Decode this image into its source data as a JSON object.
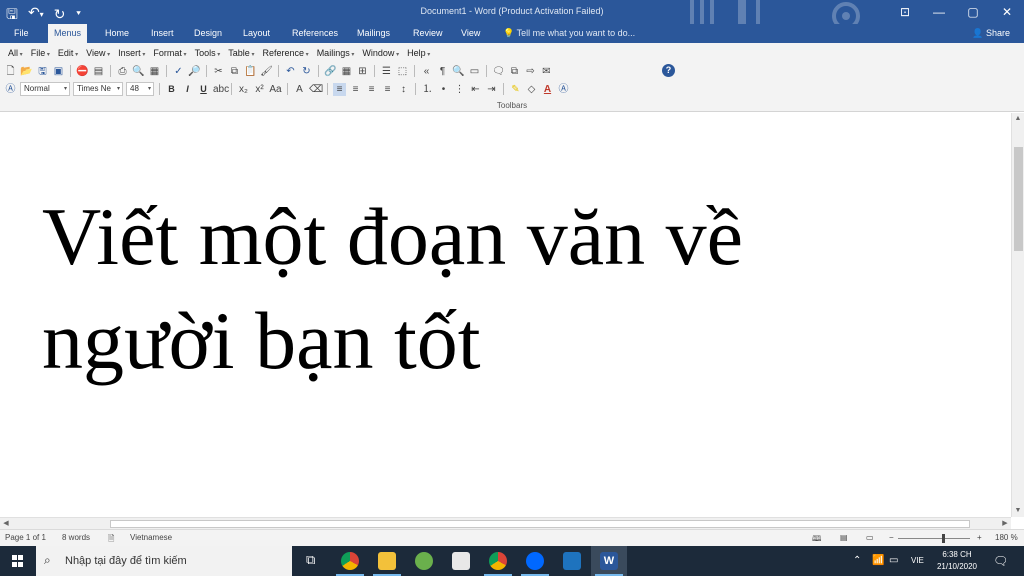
{
  "titlebar": {
    "title": "Document1 - Word (Product Activation Failed)",
    "controls": [
      "⊡",
      "—",
      "▢",
      "✕"
    ]
  },
  "tabs": [
    {
      "label": "File"
    },
    {
      "label": "Menus"
    },
    {
      "label": "Home"
    },
    {
      "label": "Insert"
    },
    {
      "label": "Design"
    },
    {
      "label": "Layout"
    },
    {
      "label": "References"
    },
    {
      "label": "Mailings"
    },
    {
      "label": "Review"
    },
    {
      "label": "View"
    }
  ],
  "tellme": "Tell me what you want to do...",
  "share": "Share",
  "menubar": [
    "All",
    "File",
    "Edit",
    "View",
    "Insert",
    "Format",
    "Tools",
    "Table",
    "Reference",
    "Mailings",
    "Window",
    "Help"
  ],
  "format": {
    "style": "Normal",
    "font": "Times Ne",
    "size": "48",
    "bold": "B",
    "italic": "I",
    "underline": "U"
  },
  "toolbars_label": "Toolbars",
  "document": {
    "line1": "Viết một đoạn văn về",
    "line2": "người bạn tốt"
  },
  "status": {
    "page": "Page 1 of 1",
    "words": "8 words",
    "language": "Vietnamese",
    "zoom": "180 %",
    "zoom_percent": 180
  },
  "taskbar": {
    "search_placeholder": "Nhập tại đây để tìm kiếm",
    "language": "VIE",
    "time": "6:38 CH",
    "date": "21/10/2020"
  },
  "colors": {
    "accent": "#2b579a",
    "taskbar": "#1c2a3a"
  }
}
